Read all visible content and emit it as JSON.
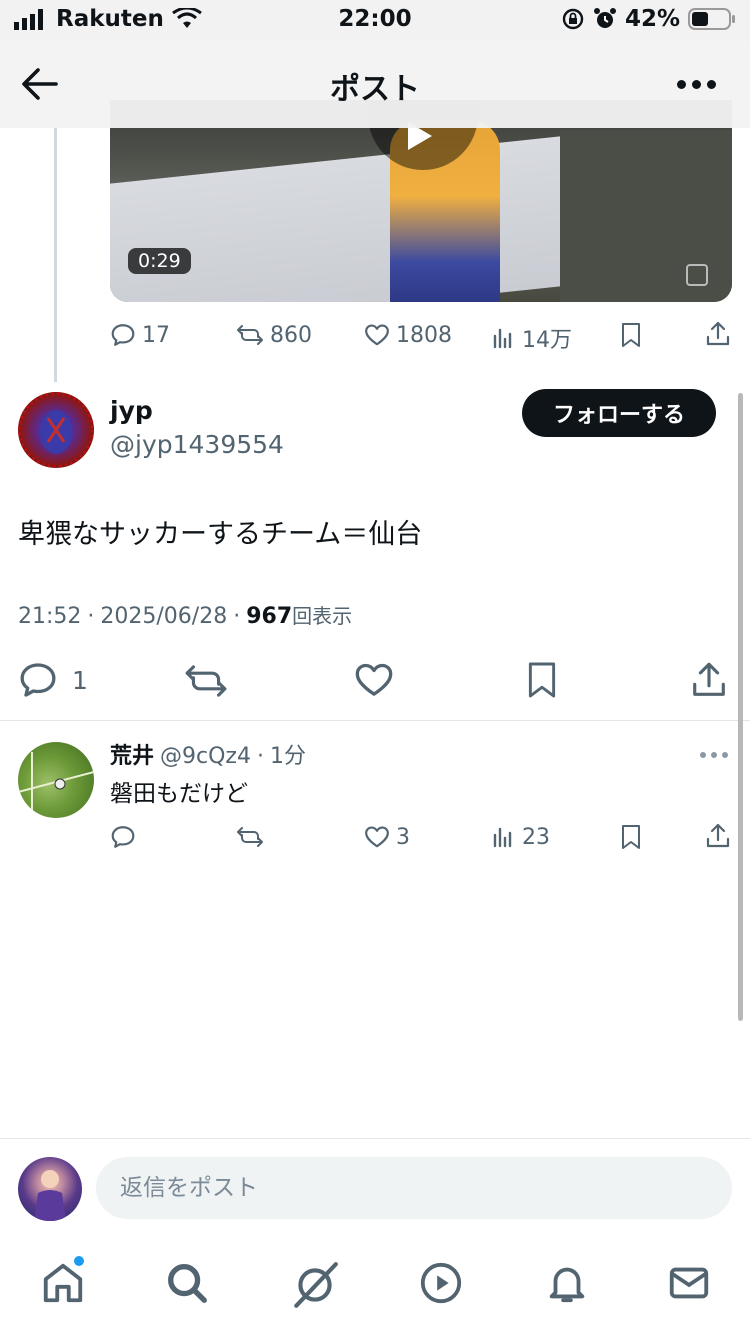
{
  "status_bar": {
    "carrier": "Rakuten",
    "time": "22:00",
    "battery": "42%",
    "icons": [
      "signal-icon",
      "wifi-icon",
      "rotation-lock-icon",
      "alarm-icon",
      "battery-icon"
    ]
  },
  "header": {
    "title": "ポスト"
  },
  "parent_post": {
    "video_duration": "0:29",
    "replies": "17",
    "reposts": "860",
    "likes": "1808",
    "views": "14万"
  },
  "main_post": {
    "author_name": "jyp",
    "author_handle": "@jyp1439554",
    "follow_label": "フォローする",
    "text": "卑猥なサッカーするチーム＝仙台",
    "time": "21:52",
    "date": "2025/06/28",
    "views_count": "967",
    "views_label": "回表示",
    "separator": "·",
    "replies": "1"
  },
  "reply": {
    "author_name": "荒井",
    "author_handle": "@9cQz4",
    "time_ago": "1分",
    "separator": "·",
    "text": "磐田もだけど",
    "likes": "3",
    "views": "23"
  },
  "composer": {
    "placeholder": "返信をポスト"
  },
  "tab_bar": {
    "items": [
      "home-icon",
      "search-icon",
      "grok-icon",
      "video-icon",
      "notifications-icon",
      "messages-icon"
    ]
  },
  "colors": {
    "accent": "#1d9bf0",
    "text": "#0f1419",
    "muted": "#536471",
    "follow_button": "#0f1419"
  }
}
